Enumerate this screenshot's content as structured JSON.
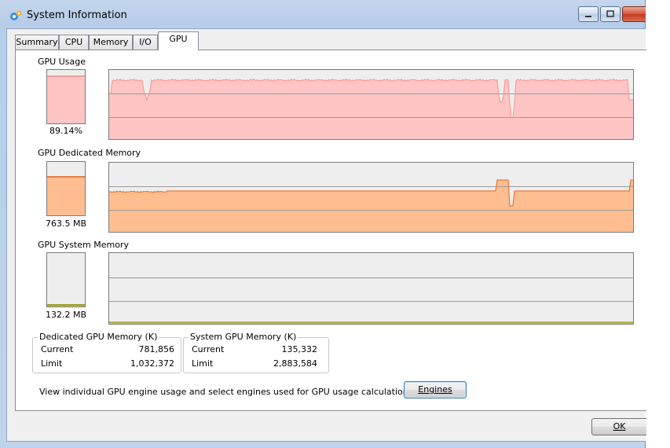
{
  "window": {
    "title": "System Information",
    "icon": "system-info-icon"
  },
  "tabs": [
    {
      "label": "Summary",
      "active": false
    },
    {
      "label": "CPU",
      "active": false
    },
    {
      "label": "Memory",
      "active": false
    },
    {
      "label": "I/O",
      "active": false
    },
    {
      "label": "GPU",
      "active": true
    }
  ],
  "sections": {
    "usage": {
      "title": "GPU Usage",
      "value_text": "89.14%",
      "fraction": 0.8914,
      "color": "#f59d98",
      "fill": "#ffc4c4"
    },
    "dedicated": {
      "title": "GPU Dedicated Memory",
      "value_text": "763.5 MB",
      "fraction": 0.74,
      "color": "#e8783c",
      "fill": "#ffbd90"
    },
    "system": {
      "title": "GPU System Memory",
      "value_text": "132.2 MB",
      "fraction": 0.046,
      "color": "#9a9a1a",
      "fill": "#c8c860"
    }
  },
  "dedicated_group": {
    "title": "Dedicated GPU Memory (K)",
    "current_label": "Current",
    "current_value": "781,856",
    "limit_label": "Limit",
    "limit_value": "1,032,372"
  },
  "system_group": {
    "title": "System GPU Memory (K)",
    "current_label": "Current",
    "current_value": "135,332",
    "limit_label": "Limit",
    "limit_value": "2,883,584"
  },
  "engines": {
    "text": "View individual GPU engine usage and select engines used for GPU usage calculations:",
    "button_label": "Engines"
  },
  "ok_label": "OK"
}
